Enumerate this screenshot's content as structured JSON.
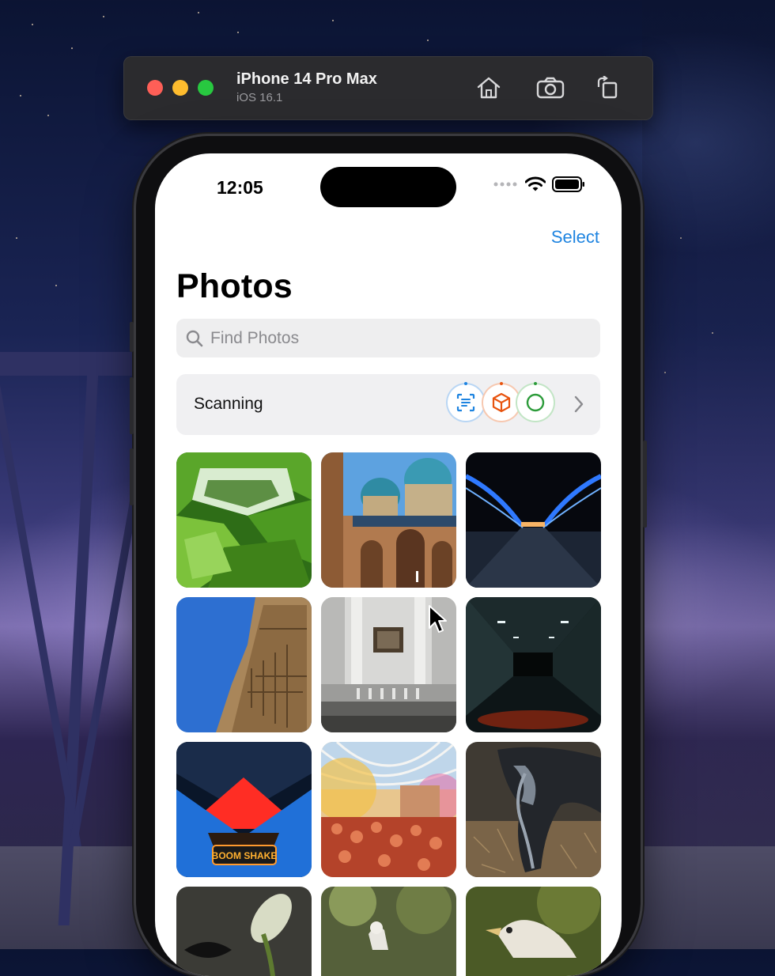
{
  "simulator": {
    "device_name": "iPhone 14 Pro Max",
    "os_version": "iOS 16.1",
    "buttons": [
      "home-icon",
      "screenshot-icon",
      "rotate-icon"
    ]
  },
  "status_bar": {
    "time": "12:05",
    "icons": [
      "signal-icon",
      "wifi-icon",
      "battery-icon"
    ]
  },
  "nav": {
    "select_label": "Select",
    "title": "Photos"
  },
  "search": {
    "placeholder": "Find Photos"
  },
  "scanning": {
    "label": "Scanning",
    "icons": [
      "text-scan-icon",
      "object-cube-icon",
      "circle-progress-icon"
    ],
    "colors": {
      "text": "#1e84e0",
      "object": "#e8540f",
      "circle": "#2c9b3a"
    }
  },
  "photos": [
    {
      "subject": "green-geometric-building"
    },
    {
      "subject": "blue-domed-mosque"
    },
    {
      "subject": "lit-bridge-at-night"
    },
    {
      "subject": "egyptian-hieroglyph-wall"
    },
    {
      "subject": "museum-gallery-painting"
    },
    {
      "subject": "dark-tunnel"
    },
    {
      "subject": "boom-shake-neon-sign"
    },
    {
      "subject": "holi-festival-crowd"
    },
    {
      "subject": "grazing-horse"
    },
    {
      "subject": "butterfly-plant"
    },
    {
      "subject": "bird-in-garden"
    },
    {
      "subject": "vulture"
    }
  ],
  "sign_text": "BOOM SHAKE",
  "accent_color": "#1e84e0"
}
